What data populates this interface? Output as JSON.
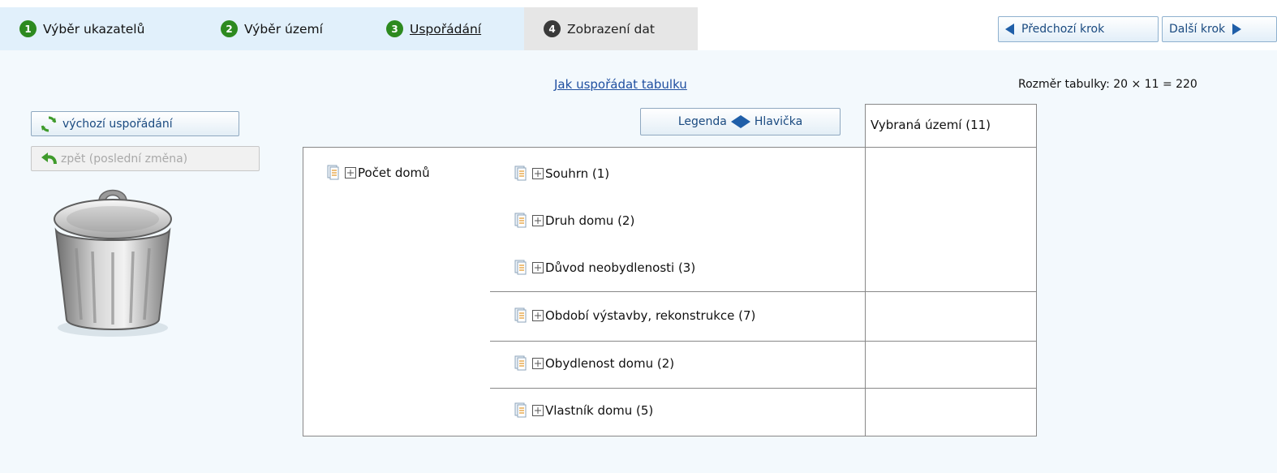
{
  "wizard": {
    "steps": [
      {
        "number": "1",
        "label": "Výběr ukazatelů"
      },
      {
        "number": "2",
        "label": "Výběr území"
      },
      {
        "number": "3",
        "label": "Uspořádání"
      },
      {
        "number": "4",
        "label": "Zobrazení dat"
      }
    ],
    "active_step": 3
  },
  "nav": {
    "prev_label": "Předchozí krok",
    "next_label": "Další krok"
  },
  "help_link": "Jak uspořádat tabulku",
  "table_size": "Rozměr tabulky: 20 × 11 = 220",
  "side": {
    "default_layout_label": "výchozí uspořádání",
    "undo_label": "zpět (poslední změna)"
  },
  "legend_button": {
    "left_label": "Legenda",
    "right_label": "Hlavička"
  },
  "layout": {
    "column_header": "Vybraná území (11)",
    "row_dimension": "Počet domů",
    "row_items": [
      "Souhrn (1)",
      "Druh domu (2)",
      "Důvod neobydlenosti (3)",
      "Období výstavby, rekonstrukce (7)",
      "Obydlenost domu (2)",
      "Vlastník domu (5)"
    ]
  },
  "colors": {
    "panel_bg": "#f3f9fd",
    "tab_bg": "#e1f0fb",
    "tab_inactive_bg": "#e6e6e6",
    "step_badge": "#2d8a1f",
    "link": "#1f4fa0"
  }
}
